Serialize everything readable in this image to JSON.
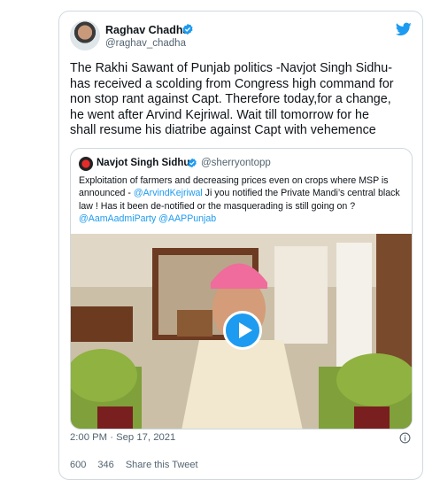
{
  "tweet": {
    "author_name": "Raghav Chadha",
    "author_handle": "@raghav_chadha",
    "text": "The Rakhi Sawant of Punjab politics -Navjot Singh Sidhu-\nhas received a scolding from Congress high command for\nnon stop rant against Capt. Therefore today,for a change,\nhe went after Arvind Kejriwal. Wait till tomorrow for he\nshall resume his diatribe against Capt with vehemence",
    "timestamp": "2:00 PM · Sep 17, 2021"
  },
  "quote": {
    "author_name": "Navjot Singh Sidhu",
    "author_handle": "@sherryontopp",
    "text_1": "Exploitation of farmers and decreasing prices even on crops where MSP is announced - ",
    "mention_1": "@ArvindKejriwal",
    "text_2": " Ji you notified the Private Mandi’s central black law ! Has it been de-notified or the masquerading is still going on ? ",
    "mention_2": "@AamAadmiParty",
    "text_3": " ",
    "mention_3": "@AAPPunjab"
  },
  "actions": {
    "likes": "600",
    "replies": "346",
    "share": "Share this Tweet"
  },
  "colors": {
    "accent": "#1d9bf0",
    "text": "#0f1419",
    "muted": "#536471"
  }
}
